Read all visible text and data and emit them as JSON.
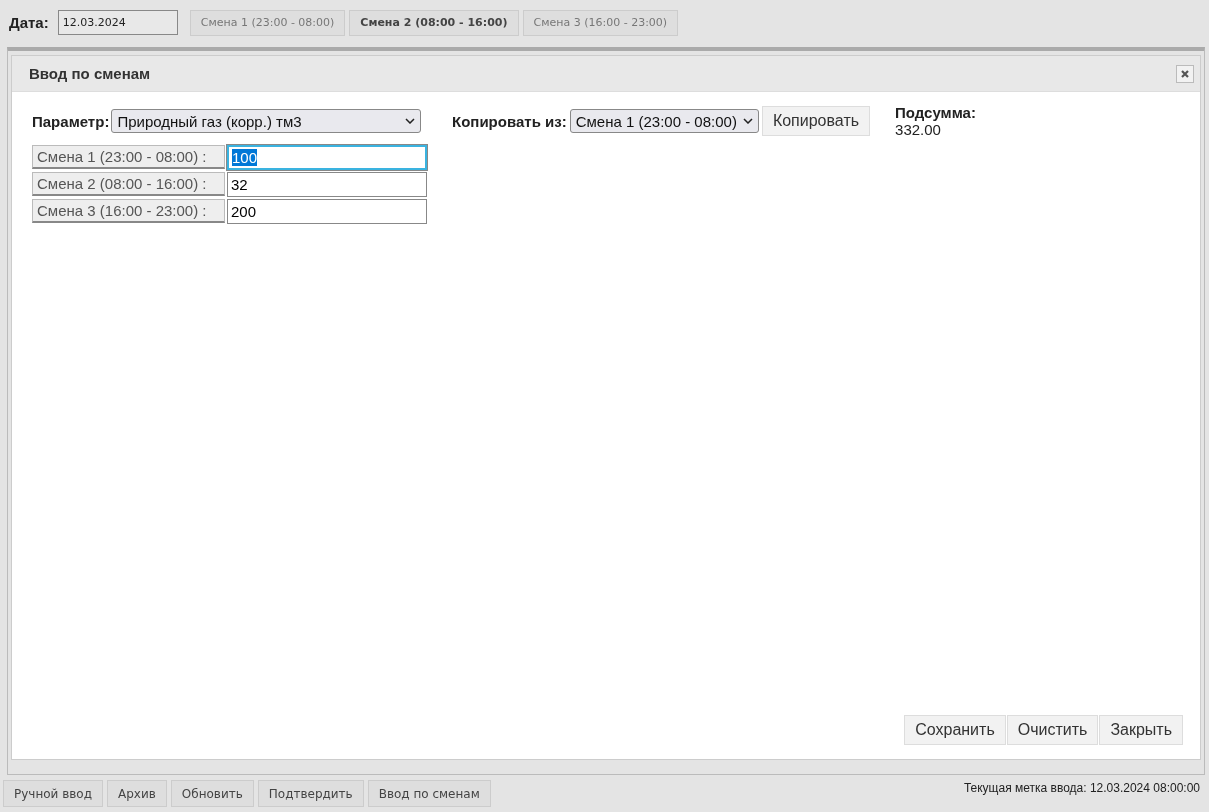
{
  "date": {
    "label": "Дата:",
    "value": "12.03.2024"
  },
  "shift_tabs": [
    {
      "label": "Смена 1 (23:00 - 08:00)",
      "selected": false
    },
    {
      "label": "Смена 2 (08:00 - 16:00)",
      "selected": true
    },
    {
      "label": "Смена 3 (16:00 - 23:00)",
      "selected": false
    }
  ],
  "dialog": {
    "title": "Ввод по сменам",
    "parameter": {
      "label": "Параметр:",
      "value": "Природный газ (корр.) тм3"
    },
    "copy": {
      "label": "Копировать из:",
      "value": "Смена 1 (23:00 - 08:00)",
      "button": "Копировать"
    },
    "subtotal": {
      "label": "Подсумма:",
      "value": "332.00"
    },
    "shifts": [
      {
        "label": "Смена 1 (23:00 - 08:00) :",
        "value": "100",
        "focused": true
      },
      {
        "label": "Смена 2 (08:00 - 16:00) :",
        "value": "32",
        "focused": false
      },
      {
        "label": "Смена 3 (16:00 - 23:00) :",
        "value": "200",
        "focused": false
      }
    ],
    "buttons": [
      "Сохранить",
      "Очистить",
      "Закрыть"
    ]
  },
  "toolbar": [
    "Ручной ввод",
    "Архив",
    "Обновить",
    "Подтвердить",
    "Ввод по сменам"
  ],
  "status": "Текущая метка ввода: 12.03.2024 08:00:00"
}
